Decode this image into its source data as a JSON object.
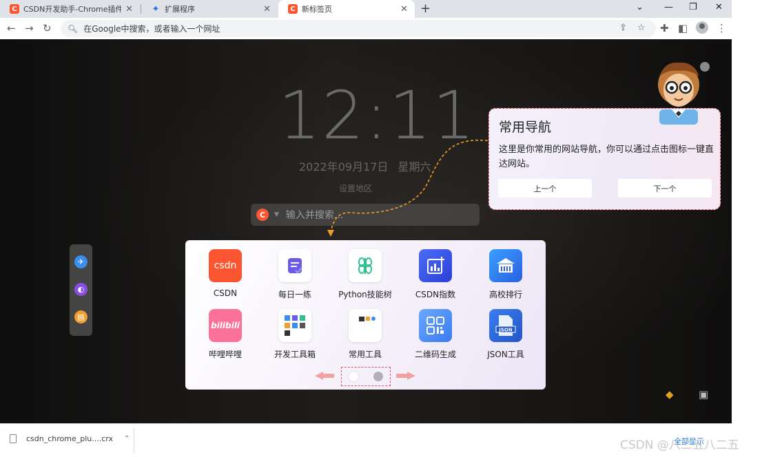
{
  "browser": {
    "tabs": [
      {
        "title": "CSDN开发助手-Chrome插件 程",
        "favicon": "csdn-icon"
      },
      {
        "title": "扩展程序",
        "favicon": "puzzle-icon"
      },
      {
        "title": "新标签页",
        "favicon": "csdn-icon"
      }
    ],
    "omnibox_placeholder": "在Google中搜索，或者输入一个网址"
  },
  "newtab": {
    "clock": "12:11",
    "date": "2022年09月17日",
    "weekday": "星期六",
    "region": "设置地区",
    "search_placeholder": "输入并搜索..."
  },
  "guide": {
    "title": "常用导航",
    "text": "这里是你常用的网站导航，你可以通过点击图标一键直达网站。",
    "prev": "上一个",
    "next": "下一个"
  },
  "nav": {
    "items": [
      {
        "label": "CSDN",
        "icon": "csdn-icon",
        "color": "#fc5531"
      },
      {
        "label": "每日一练",
        "icon": "practice-icon",
        "color": "#ffffff"
      },
      {
        "label": "Python技能树",
        "icon": "skill-tree-icon",
        "color": "#ffffff"
      },
      {
        "label": "CSDN指数",
        "icon": "chart-icon",
        "color": "#3b6cf6"
      },
      {
        "label": "高校排行",
        "icon": "school-icon",
        "color": "#2f7cf6"
      },
      {
        "label": "哔哩哔哩",
        "icon": "bilibili-icon",
        "color": "#fb7299"
      },
      {
        "label": "开发工具箱",
        "icon": "toolbox-icon",
        "color": "#ffffff"
      },
      {
        "label": "常用工具",
        "icon": "tools-icon",
        "color": "#ffffff"
      },
      {
        "label": "二维码生成",
        "icon": "qrcode-icon",
        "color": "#4a8df6"
      },
      {
        "label": "JSON工具",
        "icon": "json-icon",
        "color": "#2f6fe0"
      }
    ]
  },
  "downloads": {
    "file": "csdn_chrome_plu....crx",
    "show_all": "全部显示"
  },
  "watermark": "CSDN @八二五八二五"
}
